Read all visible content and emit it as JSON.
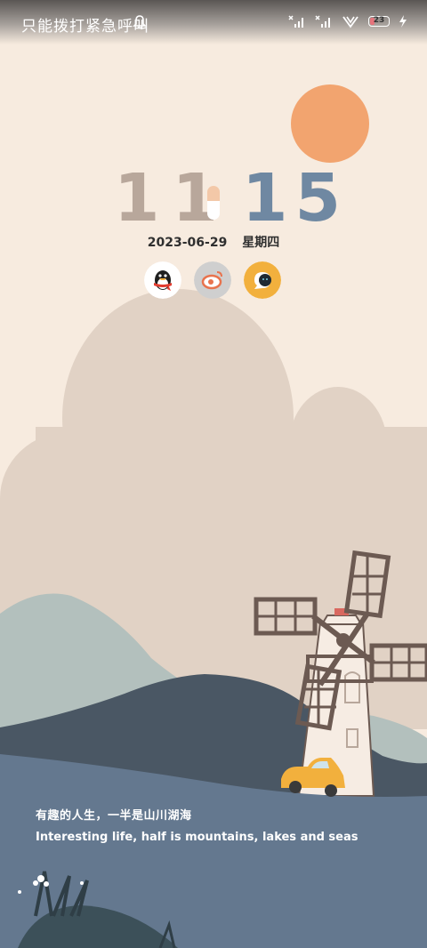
{
  "status_bar": {
    "carrier_text": "只能拨打紧急呼叫",
    "battery_level": "23",
    "charging": true
  },
  "clock": {
    "hours": "11",
    "minutes": "15",
    "date": "2023-06-29",
    "weekday": "星期四"
  },
  "shortcuts": [
    {
      "name": "QQ",
      "icon": "penguin-icon"
    },
    {
      "name": "Weibo",
      "icon": "weibo-icon"
    },
    {
      "name": "Chat",
      "icon": "chat-bubble-icon"
    }
  ],
  "quote": {
    "chinese": "有趣的人生，一半是山川湖海",
    "english": "Interesting life, half is mountains, lakes and seas"
  },
  "colors": {
    "background": "#f7ebdf",
    "sun": "#f2a46f",
    "cloud": "#e1d2c5",
    "hour_digits": "#b8a79b",
    "minute_digits": "#6f88a2",
    "sea": "#64788f"
  }
}
